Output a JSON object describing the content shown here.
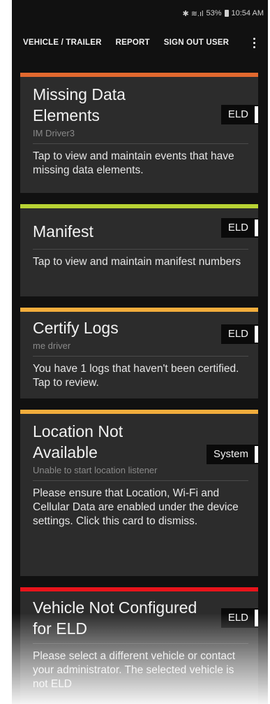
{
  "status_bar": {
    "icons": "✱ ≋.ıl",
    "battery": "53%",
    "time": "10:54 AM"
  },
  "app_bar": {
    "nav_vehicle": "VEHICLE / TRAILER",
    "nav_report": "REPORT",
    "nav_signout": "SIGN OUT USER",
    "overflow_icon": "more-vert-icon"
  },
  "cards": [
    {
      "title": "Missing Data Elements",
      "subtitle": "IM Driver3",
      "badge": "ELD",
      "body": "Tap to view and maintain events that have missing data elements.",
      "accent": "#e2692f"
    },
    {
      "title": "Manifest",
      "subtitle": "",
      "badge": "ELD",
      "body": "Tap to view and maintain manifest numbers",
      "accent": "#b8d334"
    },
    {
      "title": "Certify Logs",
      "subtitle": "me driver",
      "badge": "ELD",
      "body": "You have 1 logs that haven't been certified. Tap to review.",
      "accent": "#f2ad3c"
    },
    {
      "title": "Location Not Available",
      "subtitle": "Unable to start location listener",
      "badge": "System",
      "body": "Please ensure that Location, Wi-Fi and Cellular Data are enabled under the device settings. Click this card to dismiss.",
      "accent": "#f2ad3c"
    },
    {
      "title": "Vehicle Not Configured for ELD",
      "subtitle": "",
      "badge": "ELD",
      "body": "Please select a different vehicle or contact your administrator. The selected vehicle is not ELD",
      "accent": "#e8141b"
    }
  ]
}
